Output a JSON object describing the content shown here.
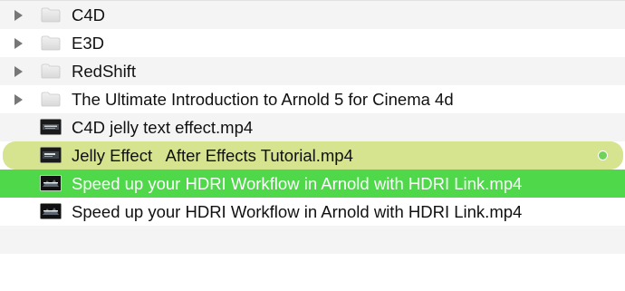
{
  "colors": {
    "alt_row": "#f4f4f5",
    "tag_green_light": "#d6e38f",
    "selection_green": "#4ed84a",
    "tag_dot": "#6fd25a"
  },
  "files": [
    {
      "name": "C4D",
      "kind": "folder",
      "icon": "folder-icon"
    },
    {
      "name": "E3D",
      "kind": "folder",
      "icon": "folder-icon"
    },
    {
      "name": "RedShift",
      "kind": "folder",
      "icon": "folder-icon"
    },
    {
      "name": "The Ultimate Introduction to Arnold 5 for Cinema 4d",
      "kind": "folder",
      "icon": "folder-icon"
    },
    {
      "name": "C4D jelly text effect.mp4",
      "kind": "video",
      "icon": "video-thumbnail-icon"
    },
    {
      "name": "Jelly Effect   After Effects Tutorial.mp4",
      "kind": "video",
      "icon": "video-thumbnail-icon",
      "tag": "green"
    },
    {
      "name": "Speed up your HDRI Workflow in Arnold with HDRI Link.mp4",
      "kind": "video",
      "icon": "video-thumbnail-icon",
      "selected": true
    },
    {
      "name": "Speed up your HDRI Workflow in Arnold with HDRI Link.mp4",
      "kind": "video",
      "icon": "video-thumbnail-icon"
    }
  ]
}
